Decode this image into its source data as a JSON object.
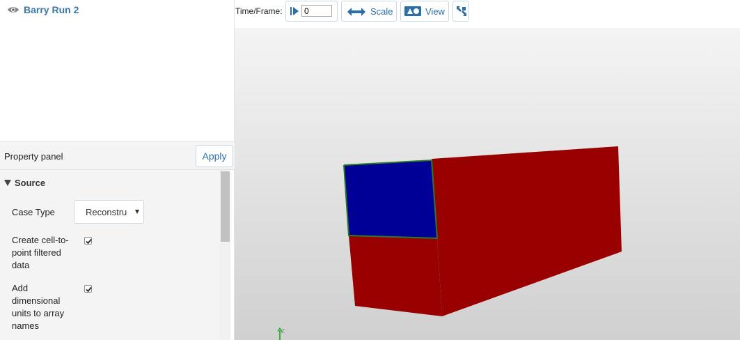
{
  "pipeline": {
    "items": [
      {
        "label": "Barry Run 2",
        "icon": "eye-icon"
      }
    ]
  },
  "property_panel": {
    "title": "Property panel",
    "apply_label": "Apply",
    "section": {
      "label": "Source",
      "expanded": true
    },
    "case_type": {
      "label": "Case Type",
      "value": "Reconstructed"
    },
    "options": [
      {
        "label": "Create cell-to-point filtered data",
        "checked": true
      },
      {
        "label": "Add dimensional units to array names",
        "checked": true
      }
    ]
  },
  "toolbar": {
    "time_label": "Time/Frame:",
    "time_value": "0",
    "scale_label": "Scale",
    "view_label": "View",
    "icons": [
      "play-icon",
      "scale-arrows-icon",
      "view-shapes-icon",
      "reset-camera-icon"
    ]
  },
  "viewport": {
    "axes_label": "Z",
    "colors": {
      "front_face": "#000096",
      "body": "#990000",
      "edge": "#2a7a2a",
      "background_top": "#f4f4f4",
      "background_bottom": "#d0d0d0",
      "accent": "#2b6fa8"
    }
  }
}
